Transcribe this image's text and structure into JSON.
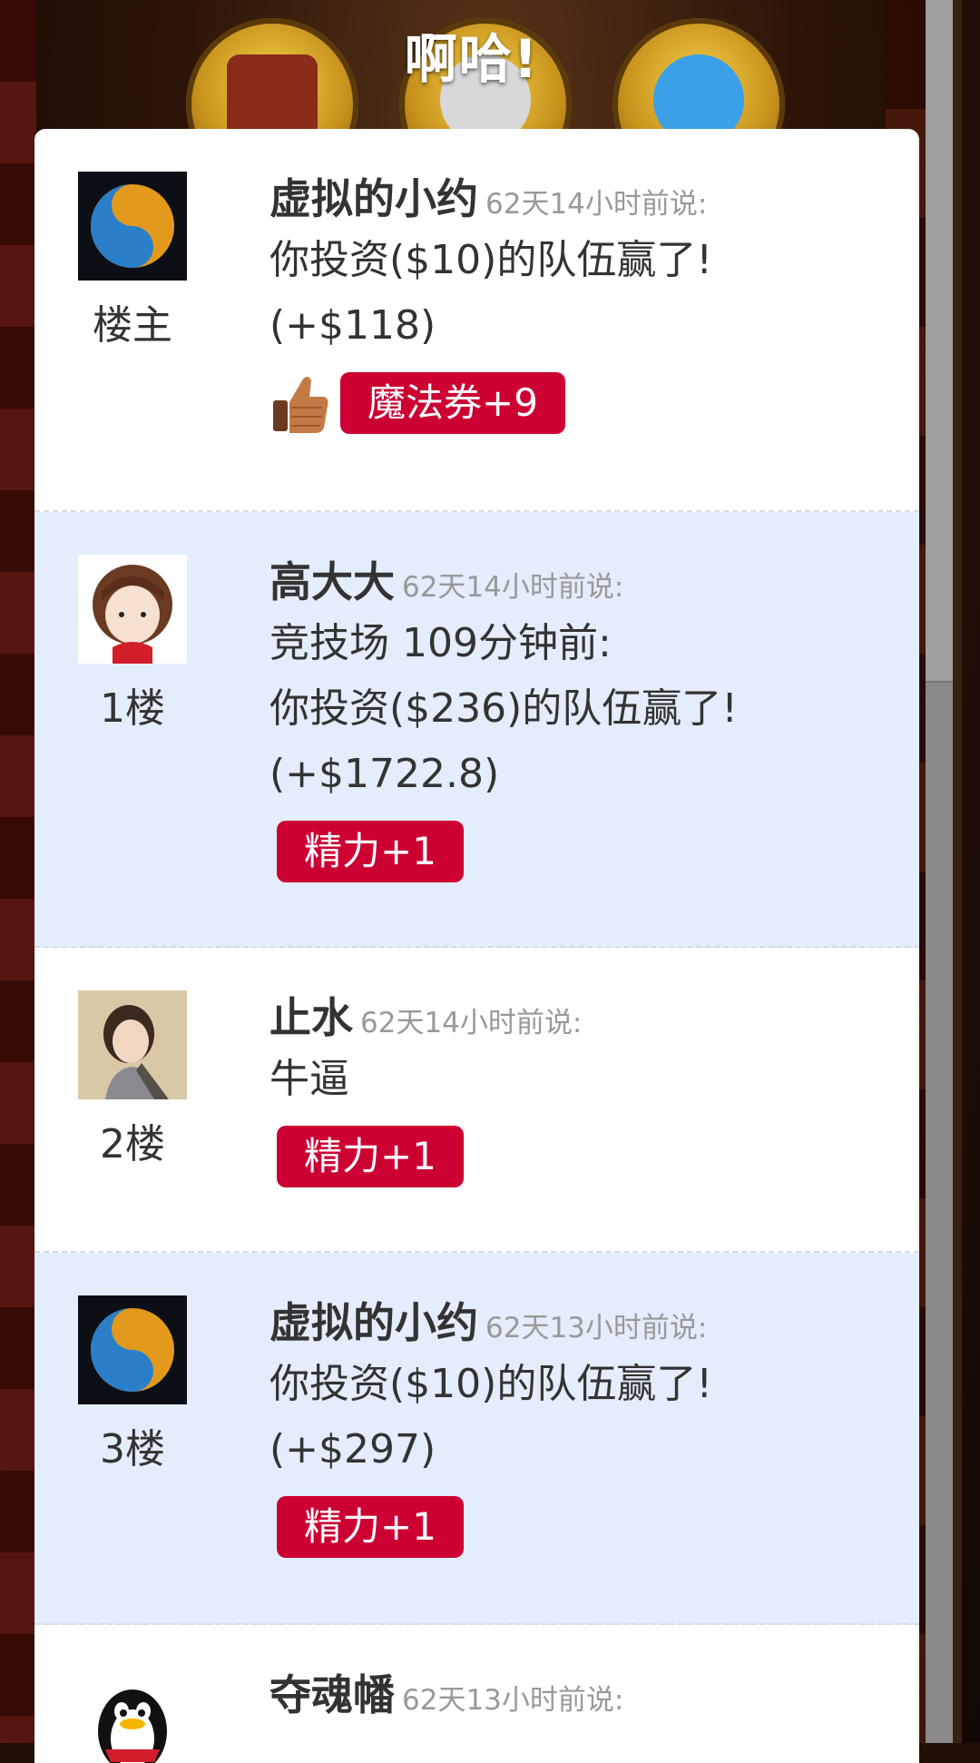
{
  "header": {
    "title": "啊哈!"
  },
  "posts": [
    {
      "floor": "楼主",
      "author": "虚拟的小约",
      "time": "62天14小时前说:",
      "text": "你投资($10)的队伍赢了!\n(+$118)",
      "reward": "魔法券+9",
      "reward_icon": "thumbs-up-icon",
      "avatar": "yin-yang-avatar"
    },
    {
      "floor": "1楼",
      "author": "高大大",
      "time": "62天14小时前说:",
      "text": "竞技场 109分钟前:\n你投资($236)的队伍赢了!\n(+$1722.8)",
      "reward": "精力+1",
      "avatar": "girl-avatar"
    },
    {
      "floor": "2楼",
      "author": "止水",
      "time": "62天14小时前说:",
      "text": "牛逼",
      "reward": "精力+1",
      "avatar": "man-avatar"
    },
    {
      "floor": "3楼",
      "author": "虚拟的小约",
      "time": "62天13小时前说:",
      "text": "你投资($10)的队伍赢了!\n(+$297)",
      "reward": "精力+1",
      "avatar": "yin-yang-avatar"
    },
    {
      "floor": "",
      "author": "夺魂幡",
      "time": "62天13小时前说:",
      "text": "",
      "reward": "",
      "avatar": "penguin-avatar"
    }
  ],
  "colors": {
    "badge": "#cc0033",
    "alt_row": "#e3edfb",
    "muted_text": "#999999"
  }
}
